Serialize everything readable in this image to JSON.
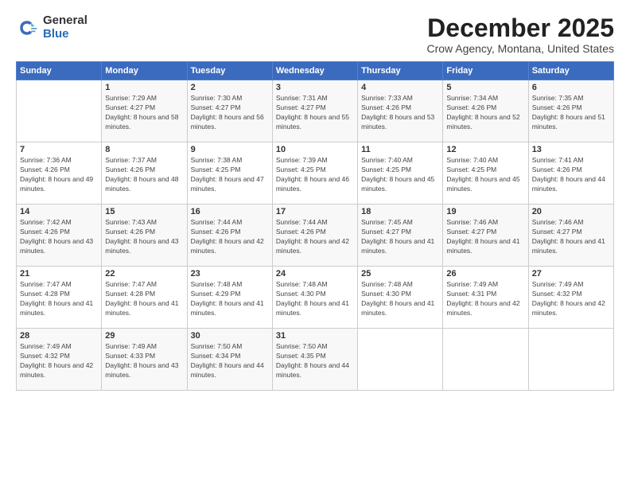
{
  "logo": {
    "general": "General",
    "blue": "Blue"
  },
  "title": "December 2025",
  "subtitle": "Crow Agency, Montana, United States",
  "days_header": [
    "Sunday",
    "Monday",
    "Tuesday",
    "Wednesday",
    "Thursday",
    "Friday",
    "Saturday"
  ],
  "weeks": [
    [
      {
        "day": "",
        "sunrise": "",
        "sunset": "",
        "daylight": ""
      },
      {
        "day": "1",
        "sunrise": "Sunrise: 7:29 AM",
        "sunset": "Sunset: 4:27 PM",
        "daylight": "Daylight: 8 hours and 58 minutes."
      },
      {
        "day": "2",
        "sunrise": "Sunrise: 7:30 AM",
        "sunset": "Sunset: 4:27 PM",
        "daylight": "Daylight: 8 hours and 56 minutes."
      },
      {
        "day": "3",
        "sunrise": "Sunrise: 7:31 AM",
        "sunset": "Sunset: 4:27 PM",
        "daylight": "Daylight: 8 hours and 55 minutes."
      },
      {
        "day": "4",
        "sunrise": "Sunrise: 7:33 AM",
        "sunset": "Sunset: 4:26 PM",
        "daylight": "Daylight: 8 hours and 53 minutes."
      },
      {
        "day": "5",
        "sunrise": "Sunrise: 7:34 AM",
        "sunset": "Sunset: 4:26 PM",
        "daylight": "Daylight: 8 hours and 52 minutes."
      },
      {
        "day": "6",
        "sunrise": "Sunrise: 7:35 AM",
        "sunset": "Sunset: 4:26 PM",
        "daylight": "Daylight: 8 hours and 51 minutes."
      }
    ],
    [
      {
        "day": "7",
        "sunrise": "Sunrise: 7:36 AM",
        "sunset": "Sunset: 4:26 PM",
        "daylight": "Daylight: 8 hours and 49 minutes."
      },
      {
        "day": "8",
        "sunrise": "Sunrise: 7:37 AM",
        "sunset": "Sunset: 4:26 PM",
        "daylight": "Daylight: 8 hours and 48 minutes."
      },
      {
        "day": "9",
        "sunrise": "Sunrise: 7:38 AM",
        "sunset": "Sunset: 4:25 PM",
        "daylight": "Daylight: 8 hours and 47 minutes."
      },
      {
        "day": "10",
        "sunrise": "Sunrise: 7:39 AM",
        "sunset": "Sunset: 4:25 PM",
        "daylight": "Daylight: 8 hours and 46 minutes."
      },
      {
        "day": "11",
        "sunrise": "Sunrise: 7:40 AM",
        "sunset": "Sunset: 4:25 PM",
        "daylight": "Daylight: 8 hours and 45 minutes."
      },
      {
        "day": "12",
        "sunrise": "Sunrise: 7:40 AM",
        "sunset": "Sunset: 4:25 PM",
        "daylight": "Daylight: 8 hours and 45 minutes."
      },
      {
        "day": "13",
        "sunrise": "Sunrise: 7:41 AM",
        "sunset": "Sunset: 4:26 PM",
        "daylight": "Daylight: 8 hours and 44 minutes."
      }
    ],
    [
      {
        "day": "14",
        "sunrise": "Sunrise: 7:42 AM",
        "sunset": "Sunset: 4:26 PM",
        "daylight": "Daylight: 8 hours and 43 minutes."
      },
      {
        "day": "15",
        "sunrise": "Sunrise: 7:43 AM",
        "sunset": "Sunset: 4:26 PM",
        "daylight": "Daylight: 8 hours and 43 minutes."
      },
      {
        "day": "16",
        "sunrise": "Sunrise: 7:44 AM",
        "sunset": "Sunset: 4:26 PM",
        "daylight": "Daylight: 8 hours and 42 minutes."
      },
      {
        "day": "17",
        "sunrise": "Sunrise: 7:44 AM",
        "sunset": "Sunset: 4:26 PM",
        "daylight": "Daylight: 8 hours and 42 minutes."
      },
      {
        "day": "18",
        "sunrise": "Sunrise: 7:45 AM",
        "sunset": "Sunset: 4:27 PM",
        "daylight": "Daylight: 8 hours and 41 minutes."
      },
      {
        "day": "19",
        "sunrise": "Sunrise: 7:46 AM",
        "sunset": "Sunset: 4:27 PM",
        "daylight": "Daylight: 8 hours and 41 minutes."
      },
      {
        "day": "20",
        "sunrise": "Sunrise: 7:46 AM",
        "sunset": "Sunset: 4:27 PM",
        "daylight": "Daylight: 8 hours and 41 minutes."
      }
    ],
    [
      {
        "day": "21",
        "sunrise": "Sunrise: 7:47 AM",
        "sunset": "Sunset: 4:28 PM",
        "daylight": "Daylight: 8 hours and 41 minutes."
      },
      {
        "day": "22",
        "sunrise": "Sunrise: 7:47 AM",
        "sunset": "Sunset: 4:28 PM",
        "daylight": "Daylight: 8 hours and 41 minutes."
      },
      {
        "day": "23",
        "sunrise": "Sunrise: 7:48 AM",
        "sunset": "Sunset: 4:29 PM",
        "daylight": "Daylight: 8 hours and 41 minutes."
      },
      {
        "day": "24",
        "sunrise": "Sunrise: 7:48 AM",
        "sunset": "Sunset: 4:30 PM",
        "daylight": "Daylight: 8 hours and 41 minutes."
      },
      {
        "day": "25",
        "sunrise": "Sunrise: 7:48 AM",
        "sunset": "Sunset: 4:30 PM",
        "daylight": "Daylight: 8 hours and 41 minutes."
      },
      {
        "day": "26",
        "sunrise": "Sunrise: 7:49 AM",
        "sunset": "Sunset: 4:31 PM",
        "daylight": "Daylight: 8 hours and 42 minutes."
      },
      {
        "day": "27",
        "sunrise": "Sunrise: 7:49 AM",
        "sunset": "Sunset: 4:32 PM",
        "daylight": "Daylight: 8 hours and 42 minutes."
      }
    ],
    [
      {
        "day": "28",
        "sunrise": "Sunrise: 7:49 AM",
        "sunset": "Sunset: 4:32 PM",
        "daylight": "Daylight: 8 hours and 42 minutes."
      },
      {
        "day": "29",
        "sunrise": "Sunrise: 7:49 AM",
        "sunset": "Sunset: 4:33 PM",
        "daylight": "Daylight: 8 hours and 43 minutes."
      },
      {
        "day": "30",
        "sunrise": "Sunrise: 7:50 AM",
        "sunset": "Sunset: 4:34 PM",
        "daylight": "Daylight: 8 hours and 44 minutes."
      },
      {
        "day": "31",
        "sunrise": "Sunrise: 7:50 AM",
        "sunset": "Sunset: 4:35 PM",
        "daylight": "Daylight: 8 hours and 44 minutes."
      },
      {
        "day": "",
        "sunrise": "",
        "sunset": "",
        "daylight": ""
      },
      {
        "day": "",
        "sunrise": "",
        "sunset": "",
        "daylight": ""
      },
      {
        "day": "",
        "sunrise": "",
        "sunset": "",
        "daylight": ""
      }
    ]
  ]
}
